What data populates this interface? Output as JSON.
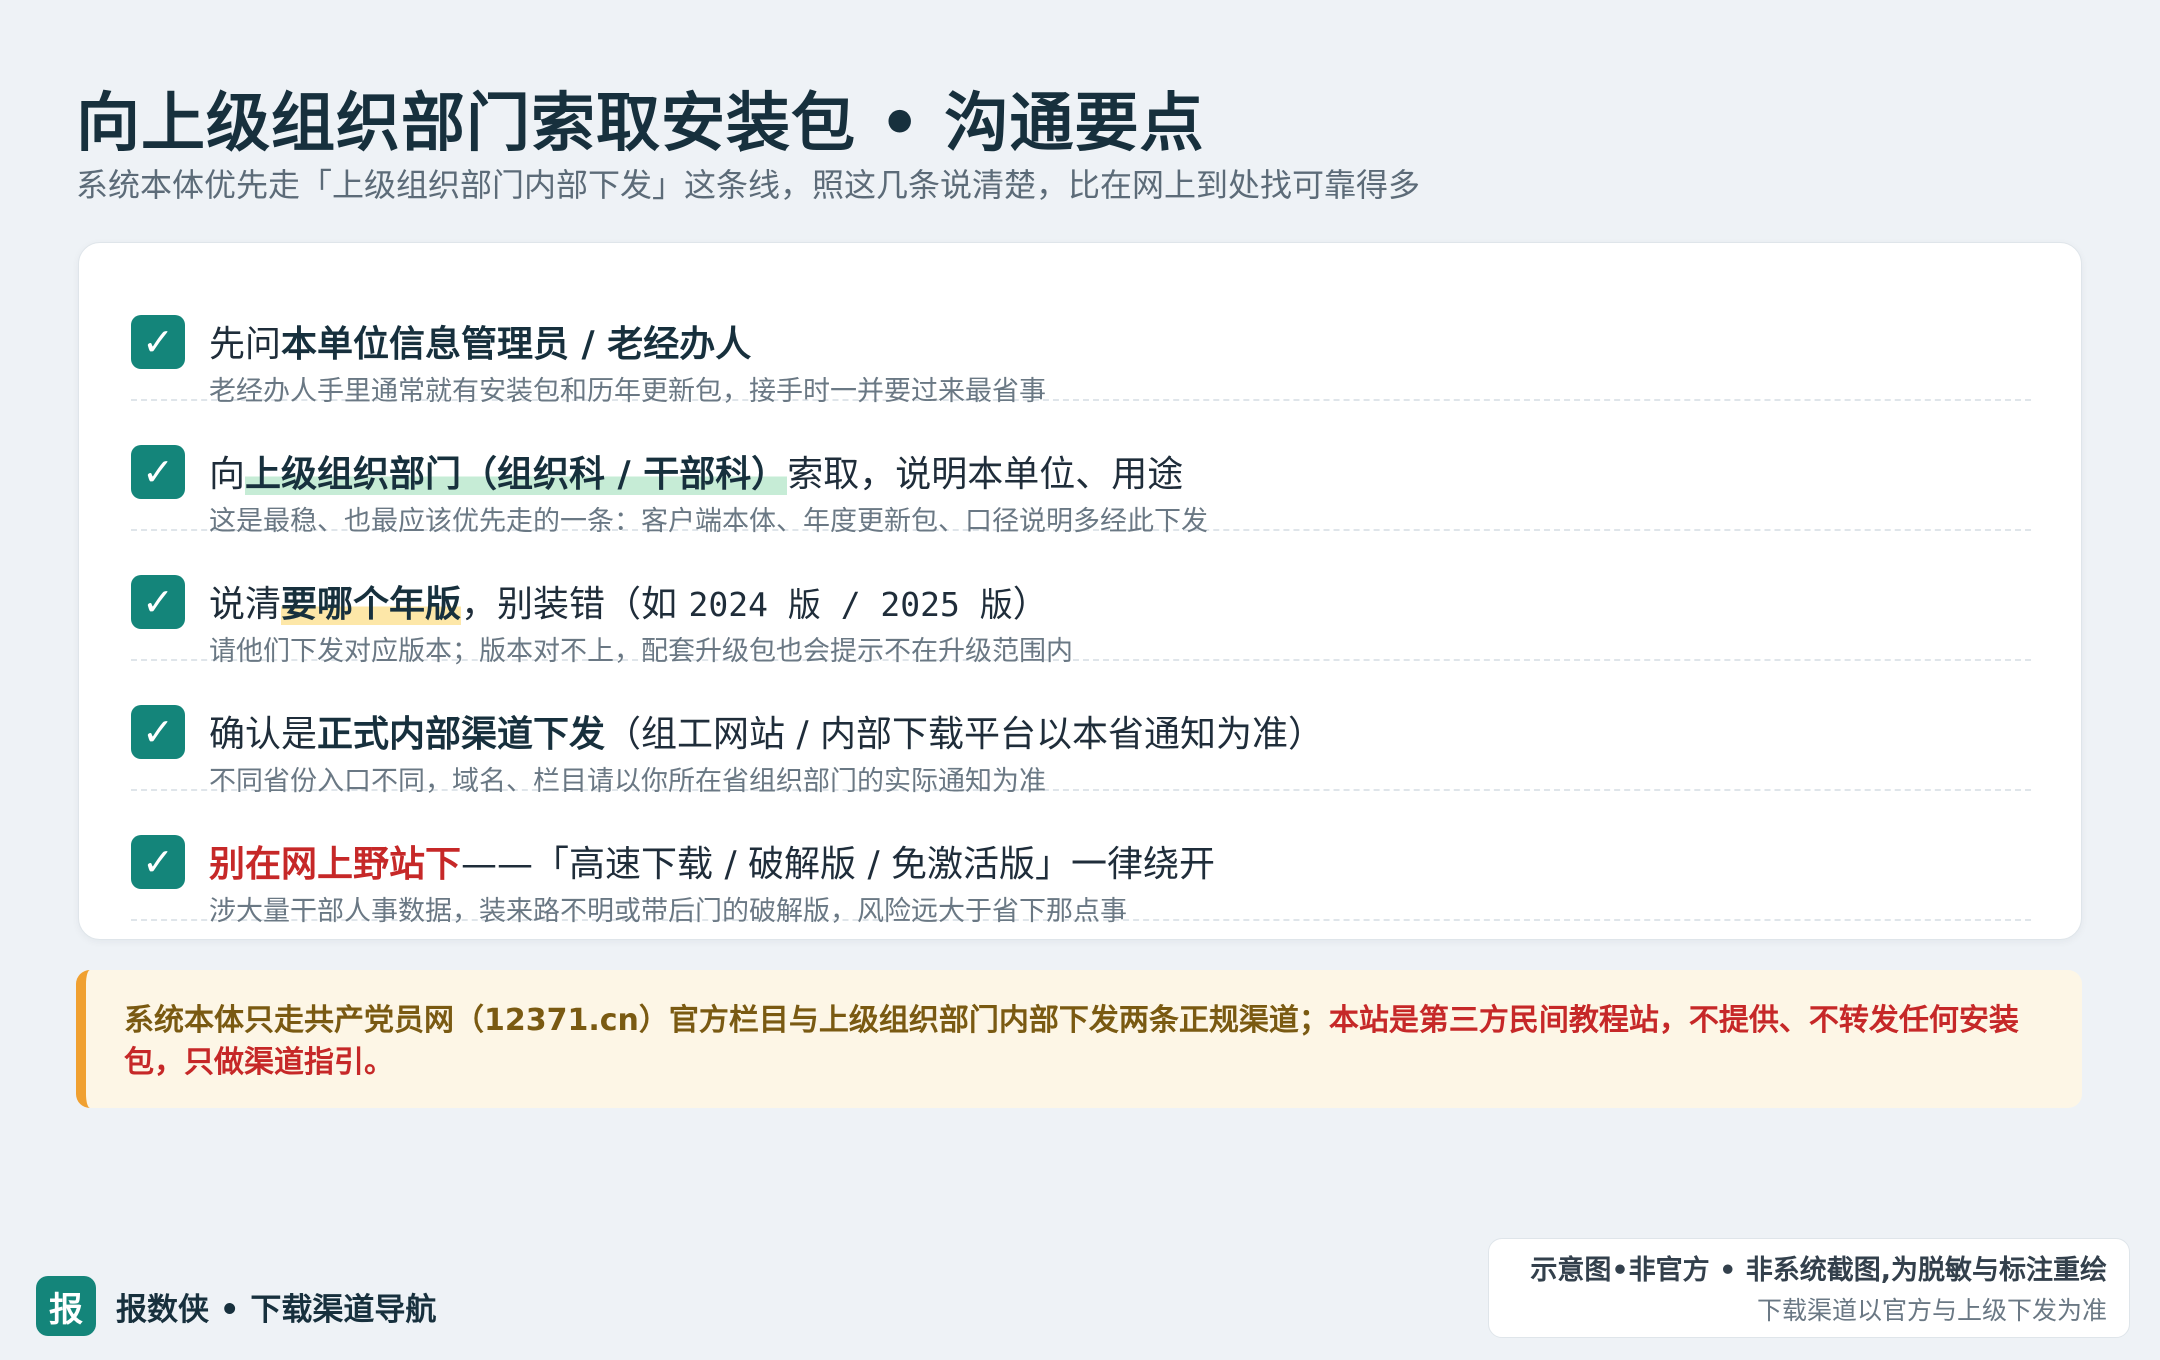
{
  "header": {
    "title": "向上级组织部门索取安装包 • 沟通要点",
    "subtitle": "系统本体优先走「上级组织部门内部下发」这条线，照这几条说清楚，比在网上到处找可靠得多"
  },
  "checklist": {
    "check_glyph": "✓",
    "items": [
      {
        "title_pre": "先问",
        "title_bold": "本单位信息管理员 / 老经办人",
        "desc": "老经办人手里通常就有安装包和历年更新包，接手时一并要过来最省事"
      },
      {
        "title_pre": "向",
        "title_bold": "上级组织部门（组织科 / 干部科）",
        "title_post": "索取，说明本单位、用途",
        "desc": "这是最稳、也最应该优先走的一条：客户端本体、年度更新包、口径说明多经此下发"
      },
      {
        "title_pre": "说清",
        "title_bold": "要哪个年版",
        "title_post1": "，别装错（如 ",
        "title_mono": "2024 版 / 2025 版",
        "title_post2": "）",
        "desc": "请他们下发对应版本；版本对不上，配套升级包也会提示不在升级范围内"
      },
      {
        "title_pre": "确认是",
        "title_bold": "正式内部渠道下发",
        "title_post": "（组工网站 / 内部下载平台以本省通知为准）",
        "desc": "不同省份入口不同，域名、栏目请以你所在省组织部门的实际通知为准"
      },
      {
        "title_red": "别在网上野站下",
        "title_post": "——「高速下载 / 破解版 / 免激活版」一律绕开",
        "desc": "涉大量干部人事数据，装来路不明或带后门的破解版，风险远大于省下那点事"
      }
    ]
  },
  "notice": {
    "text_main": "系统本体只走共产党员网（12371.cn）官方栏目与上级组织部门内部下发两条正规渠道；",
    "text_red": "本站是第三方民间教程站，不提供、不转发任何安装包，只做渠道指引。"
  },
  "brand": {
    "badge": "报",
    "name": "报数侠 • 下载渠道导航"
  },
  "disclaimer": {
    "main": "示意图•非官方 • 非系统截图,为脱敏与标注重绘",
    "sub": "下载渠道以官方与上级下发为准"
  },
  "colors": {
    "accent_teal": "#14857a",
    "warning_red": "#c62828",
    "notice_bg": "#fdf6e6",
    "notice_border": "#f0a030",
    "highlight_green": "#c6ecd6",
    "highlight_yellow": "#fde7a8"
  }
}
